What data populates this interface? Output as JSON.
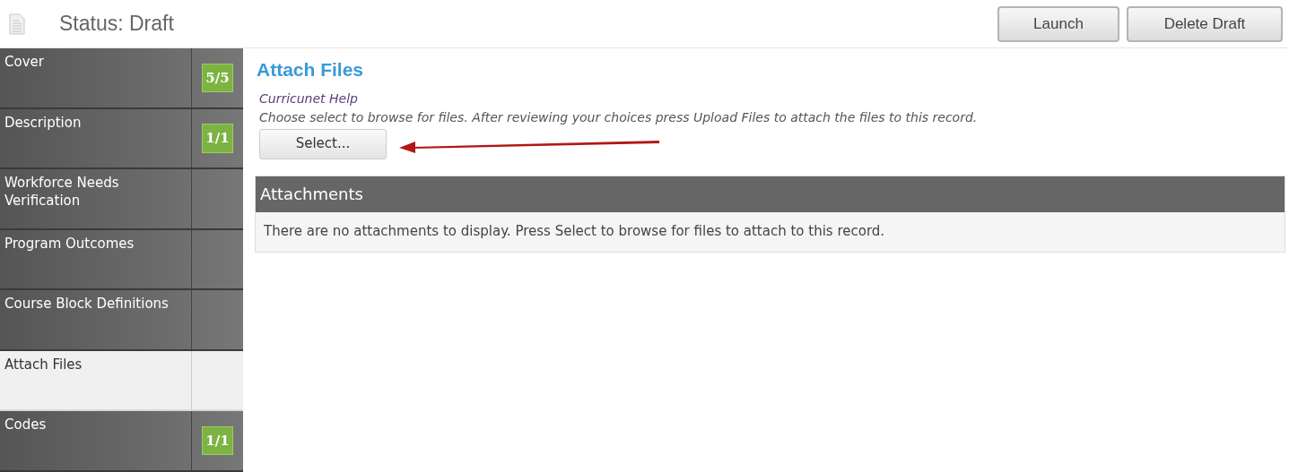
{
  "header": {
    "status": "Status: Draft",
    "buttons": [
      "Launch",
      "Delete Draft"
    ]
  },
  "sidebar": {
    "items": [
      {
        "label": "Cover",
        "badge": "5/5",
        "selected": false
      },
      {
        "label": "Description",
        "badge": "1/1",
        "selected": false
      },
      {
        "label": "Workforce Needs Verification",
        "selected": false
      },
      {
        "label": "Program Outcomes",
        "selected": false
      },
      {
        "label": "Course Block Definitions",
        "selected": false
      },
      {
        "label": "Attach Files",
        "selected": true
      },
      {
        "label": "Codes",
        "badge": "1/1",
        "selected": false
      }
    ]
  },
  "main": {
    "title": "Attach Files",
    "help_link": "Curricunet Help",
    "help_text": "Choose select to browse for files. After reviewing your choices press Upload Files to attach the files to this record.",
    "select_button": "Select...",
    "attachments": {
      "title": "Attachments",
      "empty_message": "There are no attachments to display. Press Select to browse for files to attach to this record."
    }
  }
}
